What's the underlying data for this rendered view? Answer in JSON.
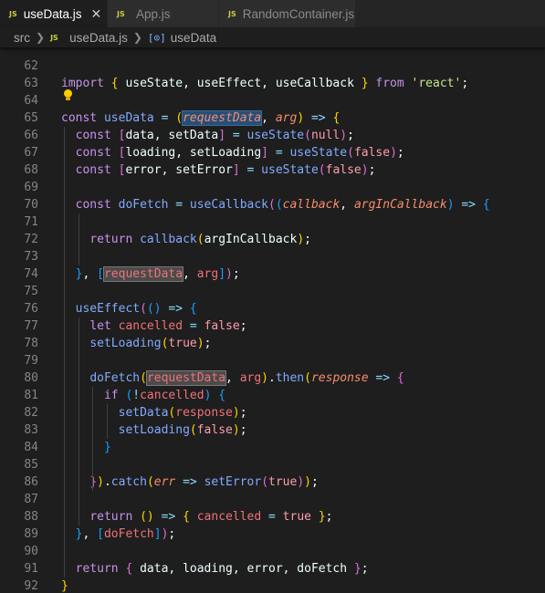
{
  "tabs": [
    {
      "label": "useData.js",
      "icon": "js-icon",
      "active": true
    },
    {
      "label": "App.js",
      "icon": "js-icon",
      "active": false
    },
    {
      "label": "RandomContainer.js",
      "icon": "js-icon",
      "active": false
    }
  ],
  "close_glyph": "✕",
  "breadcrumb": {
    "folder": "src",
    "file": "useData.js",
    "symbol": "useData"
  },
  "line_numbers": [
    "62",
    "63",
    "64",
    "65",
    "66",
    "67",
    "68",
    "69",
    "70",
    "71",
    "72",
    "73",
    "74",
    "75",
    "76",
    "77",
    "78",
    "79",
    "80",
    "81",
    "82",
    "83",
    "84",
    "85",
    "86",
    "87",
    "88",
    "89",
    "90",
    "91",
    "92"
  ],
  "lines": [
    [],
    [
      [
        "kw",
        "import "
      ],
      [
        "br1",
        "{ "
      ],
      [
        "tx",
        "useState, useEffect, useCallback "
      ],
      [
        "br1",
        "} "
      ],
      [
        "kw",
        "from "
      ],
      [
        "st",
        "'react'"
      ],
      [
        "tx",
        ";"
      ]
    ],
    [],
    [
      [
        "kw",
        "const "
      ],
      [
        "fn",
        "useData "
      ],
      [
        "pn",
        "= "
      ],
      [
        "br1",
        "("
      ],
      [
        "pr hl2",
        "requestData"
      ],
      [
        "tx",
        ", "
      ],
      [
        "pr",
        "arg"
      ],
      [
        "br1",
        ")"
      ],
      [
        "pn",
        " => "
      ],
      [
        "br1",
        "{"
      ]
    ],
    [
      [
        "tx",
        "  "
      ],
      [
        "kw",
        "const "
      ],
      [
        "br2",
        "["
      ],
      [
        "tx",
        "data, setData"
      ],
      [
        "br2",
        "]"
      ],
      [
        "pn",
        " = "
      ],
      [
        "fn",
        "useState"
      ],
      [
        "br2",
        "("
      ],
      [
        "bo",
        "null"
      ],
      [
        "br2",
        ")"
      ],
      [
        "tx",
        ";"
      ]
    ],
    [
      [
        "tx",
        "  "
      ],
      [
        "kw",
        "const "
      ],
      [
        "br2",
        "["
      ],
      [
        "tx",
        "loading, setLoading"
      ],
      [
        "br2",
        "]"
      ],
      [
        "pn",
        " = "
      ],
      [
        "fn",
        "useState"
      ],
      [
        "br2",
        "("
      ],
      [
        "bo",
        "false"
      ],
      [
        "br2",
        ")"
      ],
      [
        "tx",
        ";"
      ]
    ],
    [
      [
        "tx",
        "  "
      ],
      [
        "kw",
        "const "
      ],
      [
        "br2",
        "["
      ],
      [
        "tx",
        "error, setError"
      ],
      [
        "br2",
        "]"
      ],
      [
        "pn",
        " = "
      ],
      [
        "fn",
        "useState"
      ],
      [
        "br2",
        "("
      ],
      [
        "bo",
        "false"
      ],
      [
        "br2",
        ")"
      ],
      [
        "tx",
        ";"
      ]
    ],
    [],
    [
      [
        "tx",
        "  "
      ],
      [
        "kw",
        "const "
      ],
      [
        "fn",
        "doFetch "
      ],
      [
        "pn",
        "= "
      ],
      [
        "fn",
        "useCallback"
      ],
      [
        "br2",
        "("
      ],
      [
        "br3",
        "("
      ],
      [
        "pr",
        "callback"
      ],
      [
        "tx",
        ", "
      ],
      [
        "pr",
        "argInCallback"
      ],
      [
        "br3",
        ")"
      ],
      [
        "pn",
        " => "
      ],
      [
        "br3",
        "{"
      ]
    ],
    [],
    [
      [
        "tx",
        "    "
      ],
      [
        "kw",
        "return "
      ],
      [
        "fn",
        "callback"
      ],
      [
        "br1",
        "("
      ],
      [
        "tx",
        "argInCallback"
      ],
      [
        "br1",
        ")"
      ],
      [
        "tx",
        ";"
      ]
    ],
    [],
    [
      [
        "tx",
        "  "
      ],
      [
        "br3",
        "}"
      ],
      [
        "tx",
        ", "
      ],
      [
        "br3",
        "["
      ],
      [
        "vr hl",
        "requestData"
      ],
      [
        "tx",
        ", "
      ],
      [
        "vr",
        "arg"
      ],
      [
        "br3",
        "]"
      ],
      [
        "br2",
        ")"
      ],
      [
        "tx",
        ";"
      ]
    ],
    [],
    [
      [
        "tx",
        "  "
      ],
      [
        "fn",
        "useEffect"
      ],
      [
        "br2",
        "("
      ],
      [
        "br3",
        "()"
      ],
      [
        "pn",
        " => "
      ],
      [
        "br3",
        "{"
      ]
    ],
    [
      [
        "tx",
        "    "
      ],
      [
        "kw",
        "let "
      ],
      [
        "vr",
        "cancelled "
      ],
      [
        "pn",
        "= "
      ],
      [
        "bo",
        "false"
      ],
      [
        "tx",
        ";"
      ]
    ],
    [
      [
        "tx",
        "    "
      ],
      [
        "fn",
        "setLoading"
      ],
      [
        "br1",
        "("
      ],
      [
        "bo",
        "true"
      ],
      [
        "br1",
        ")"
      ],
      [
        "tx",
        ";"
      ]
    ],
    [],
    [
      [
        "tx",
        "    "
      ],
      [
        "fn",
        "doFetch"
      ],
      [
        "br1",
        "("
      ],
      [
        "vr hl",
        "requestData"
      ],
      [
        "tx",
        ", "
      ],
      [
        "vr",
        "arg"
      ],
      [
        "br1",
        ")"
      ],
      [
        "tx",
        "."
      ],
      [
        "fn",
        "then"
      ],
      [
        "br1",
        "("
      ],
      [
        "pr",
        "response"
      ],
      [
        "pn",
        " => "
      ],
      [
        "br2",
        "{"
      ]
    ],
    [
      [
        "tx",
        "      "
      ],
      [
        "kw",
        "if "
      ],
      [
        "br3",
        "("
      ],
      [
        "pn",
        "!"
      ],
      [
        "vr",
        "cancelled"
      ],
      [
        "br3",
        ")"
      ],
      [
        "tx",
        " "
      ],
      [
        "br3",
        "{"
      ]
    ],
    [
      [
        "tx",
        "        "
      ],
      [
        "fn",
        "setData"
      ],
      [
        "br1",
        "("
      ],
      [
        "vr",
        "response"
      ],
      [
        "br1",
        ")"
      ],
      [
        "tx",
        ";"
      ]
    ],
    [
      [
        "tx",
        "        "
      ],
      [
        "fn",
        "setLoading"
      ],
      [
        "br1",
        "("
      ],
      [
        "bo",
        "false"
      ],
      [
        "br1",
        ")"
      ],
      [
        "tx",
        ";"
      ]
    ],
    [
      [
        "tx",
        "      "
      ],
      [
        "br3",
        "}"
      ]
    ],
    [],
    [
      [
        "tx",
        "    "
      ],
      [
        "br2",
        "}"
      ],
      [
        "br1",
        ")"
      ],
      [
        "tx",
        "."
      ],
      [
        "fn",
        "catch"
      ],
      [
        "br1",
        "("
      ],
      [
        "pr",
        "err"
      ],
      [
        "pn",
        " => "
      ],
      [
        "fn",
        "setError"
      ],
      [
        "br2",
        "("
      ],
      [
        "bo",
        "true"
      ],
      [
        "br2",
        ")"
      ],
      [
        "br1",
        ")"
      ],
      [
        "tx",
        ";"
      ]
    ],
    [],
    [
      [
        "tx",
        "    "
      ],
      [
        "kw",
        "return "
      ],
      [
        "br1",
        "()"
      ],
      [
        "pn",
        " => "
      ],
      [
        "br1",
        "{ "
      ],
      [
        "vr",
        "cancelled "
      ],
      [
        "pn",
        "= "
      ],
      [
        "bo",
        "true "
      ],
      [
        "br1",
        "}"
      ],
      [
        "tx",
        ";"
      ]
    ],
    [
      [
        "tx",
        "  "
      ],
      [
        "br3",
        "}"
      ],
      [
        "tx",
        ", "
      ],
      [
        "br3",
        "["
      ],
      [
        "vr",
        "doFetch"
      ],
      [
        "br3",
        "]"
      ],
      [
        "br2",
        ")"
      ],
      [
        "tx",
        ";"
      ]
    ],
    [],
    [
      [
        "tx",
        "  "
      ],
      [
        "kw",
        "return "
      ],
      [
        "br2",
        "{ "
      ],
      [
        "tx",
        "data, loading, error, doFetch "
      ],
      [
        "br2",
        "}"
      ],
      [
        "tx",
        ";"
      ]
    ],
    [
      [
        "br1",
        "}"
      ]
    ]
  ]
}
